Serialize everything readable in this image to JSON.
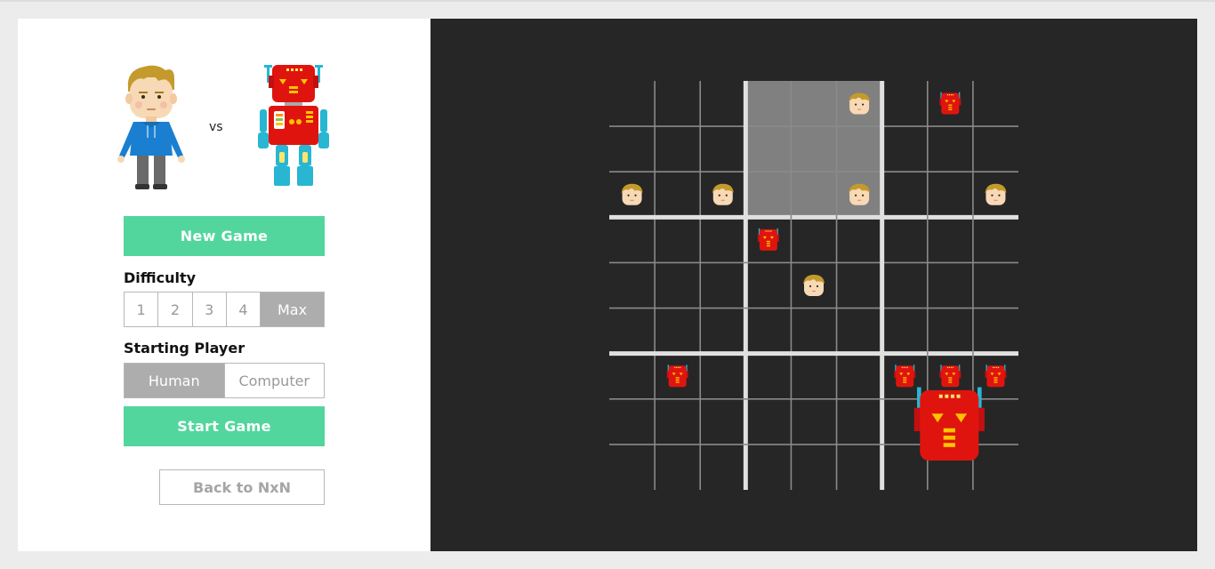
{
  "players": {
    "vs_label": "vs"
  },
  "controls": {
    "new_game_label": "New Game",
    "difficulty_title": "Difficulty",
    "difficulty_options": [
      "1",
      "2",
      "3",
      "4",
      "Max"
    ],
    "difficulty_selected": "Max",
    "starting_player_title": "Starting Player",
    "starting_player_options": [
      "Human",
      "Computer"
    ],
    "starting_player_selected": "Human",
    "start_game_label": "Start Game",
    "back_label": "Back to NxN"
  },
  "board": {
    "size": 9,
    "highlighted_block": {
      "row": 0,
      "col": 1
    },
    "human_cells": [
      [
        0,
        5
      ],
      [
        2,
        0
      ],
      [
        2,
        2
      ],
      [
        2,
        5
      ],
      [
        2,
        8
      ],
      [
        4,
        4
      ]
    ],
    "computer_cells": [
      [
        0,
        7
      ],
      [
        3,
        3
      ],
      [
        6,
        1
      ],
      [
        6,
        6
      ],
      [
        6,
        7
      ],
      [
        6,
        8
      ]
    ],
    "large_piece": {
      "cell": [
        7,
        7
      ],
      "owner": "computer"
    }
  },
  "colors": {
    "accent": "#52d69e",
    "board_bg": "#262626",
    "highlight": "#808080",
    "robot_red": "#e0140f",
    "robot_accent": "#29b6d3",
    "hair": "#c49a2c"
  }
}
